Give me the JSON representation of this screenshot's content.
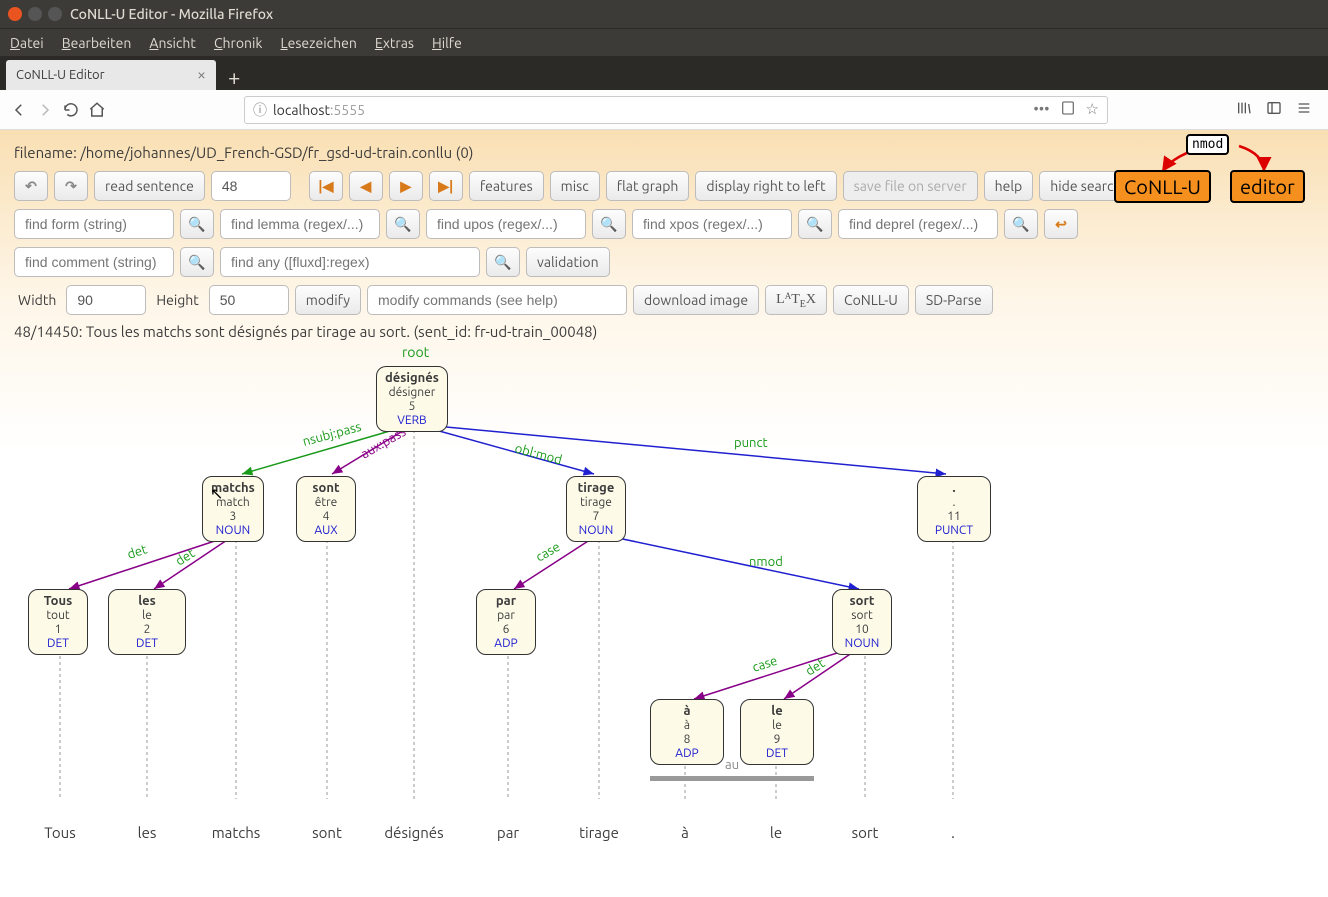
{
  "window_title": "CoNLL-U Editor - Mozilla Firefox",
  "menubar": {
    "datei": "Datei",
    "bearbeiten": "Bearbeiten",
    "ansicht": "Ansicht",
    "chronik": "Chronik",
    "lesezeichen": "Lesezeichen",
    "extras": "Extras",
    "hilfe": "Hilfe"
  },
  "tab_title": "CoNLL-U Editor",
  "url_host": "localhost",
  "url_port": ":5555",
  "filename_label": "filename: /home/johannes/UD_French-GSD/fr_gsd-ud-train.conllu (0)",
  "toolbar": {
    "read_sentence": "read sentence",
    "sentence_num": "48",
    "features": "features",
    "misc": "misc",
    "flat_graph": "flat graph",
    "display_rtl": "display right to left",
    "save_file": "save file on server",
    "help": "help",
    "hide_search": "hide search"
  },
  "search": {
    "form": "find form (string)",
    "lemma": "find lemma (regex/...)",
    "upos": "find upos (regex/...)",
    "xpos": "find xpos (regex/...)",
    "deprel": "find deprel (regex/...)",
    "comment": "find comment (string)",
    "any": "find any ([fluxd]:regex)",
    "validation": "validation"
  },
  "mod": {
    "width_label": "Width",
    "width_val": "90",
    "height_label": "Height",
    "height_val": "50",
    "modify": "modify",
    "modify_cmd": "modify commands (see help)",
    "download": "download image",
    "latex": "LATEX",
    "conllu": "CoNLL-U",
    "sdparse": "SD-Parse"
  },
  "logo": {
    "conllu": "CoNLL-U",
    "editor": "editor",
    "nmod": "nmod"
  },
  "sentence_info": "48/14450: Tous les matchs sont désignés par tirage au sort. (sent_id: fr-ud-train_00048)",
  "root_label": "root",
  "nodes": {
    "n5": {
      "form": "désignés",
      "lemma": "désigner",
      "id": "5",
      "upos": "VERB"
    },
    "n3": {
      "form": "matchs",
      "lemma": "match",
      "id": "3",
      "upos": "NOUN"
    },
    "n4": {
      "form": "sont",
      "lemma": "être",
      "id": "4",
      "upos": "AUX"
    },
    "n7": {
      "form": "tirage",
      "lemma": "tirage",
      "id": "7",
      "upos": "NOUN"
    },
    "n11": {
      "form": ".",
      "lemma": ".",
      "id": "11",
      "upos": "PUNCT"
    },
    "n1": {
      "form": "Tous",
      "lemma": "tout",
      "id": "1",
      "upos": "DET"
    },
    "n2": {
      "form": "les",
      "lemma": "le",
      "id": "2",
      "upos": "DET"
    },
    "n6": {
      "form": "par",
      "lemma": "par",
      "id": "6",
      "upos": "ADP"
    },
    "n10": {
      "form": "sort",
      "lemma": "sort",
      "id": "10",
      "upos": "NOUN"
    },
    "n8": {
      "form": "à",
      "lemma": "à",
      "id": "8",
      "upos": "ADP"
    },
    "n9": {
      "form": "le",
      "lemma": "le",
      "id": "9",
      "upos": "DET"
    }
  },
  "deprels": {
    "nsubj": "nsubj:pass",
    "aux": "aux:pass",
    "obl": "obl:mod",
    "punct": "punct",
    "det1": "det",
    "det2": "det",
    "case1": "case",
    "nmod": "nmod",
    "case2": "case",
    "det3": "det"
  },
  "mwt_label": "au",
  "tokens": [
    "Tous",
    "les",
    "matchs",
    "sont",
    "désignés",
    "par",
    "tirage",
    "à",
    "le",
    "sort",
    "."
  ]
}
